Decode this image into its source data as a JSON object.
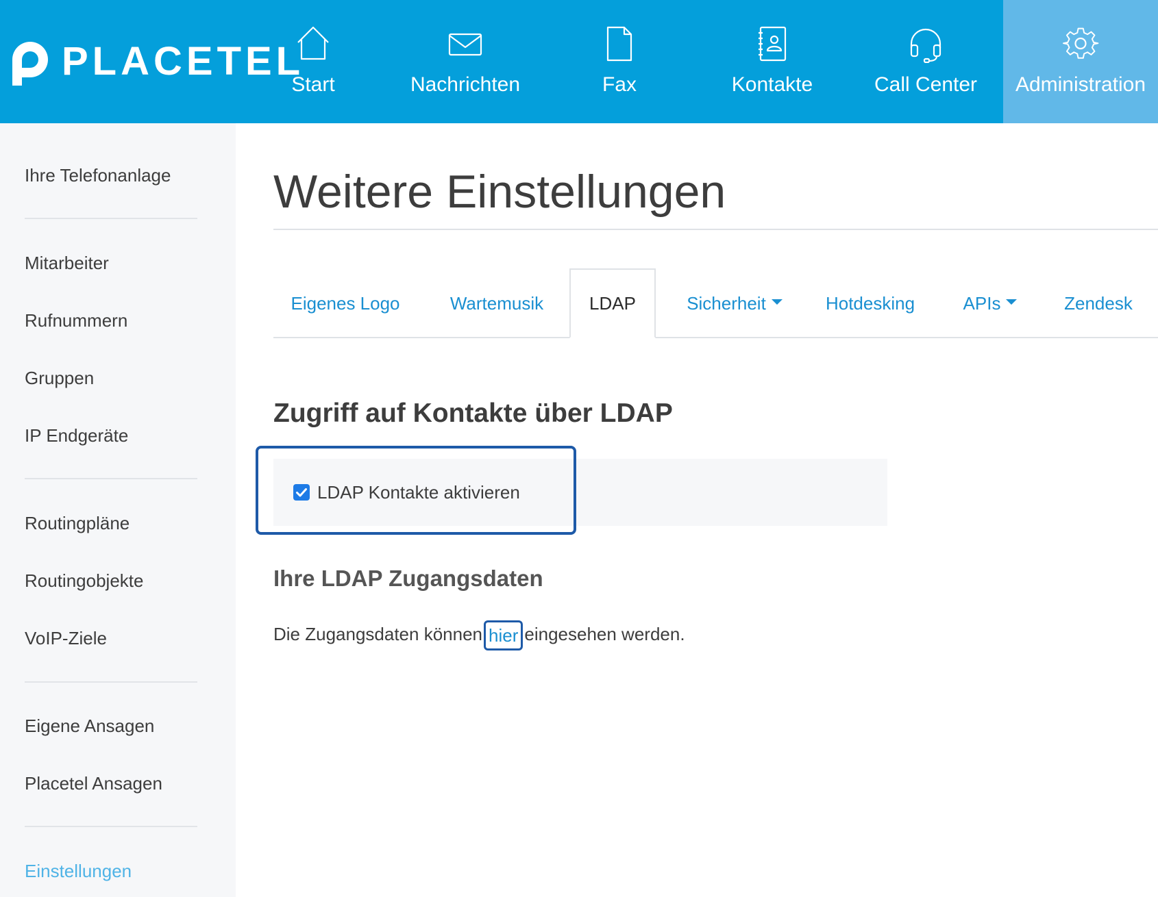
{
  "brand": {
    "name": "PLACETEL"
  },
  "nav": {
    "items": [
      {
        "label": "Start",
        "icon": "home-icon"
      },
      {
        "label": "Nachrichten",
        "icon": "envelope-icon"
      },
      {
        "label": "Fax",
        "icon": "document-icon"
      },
      {
        "label": "Kontakte",
        "icon": "address-book-icon"
      },
      {
        "label": "Call Center",
        "icon": "headset-icon"
      },
      {
        "label": "Administration",
        "icon": "gear-icon",
        "active": true
      }
    ]
  },
  "sidebar": {
    "items": [
      {
        "label": "Ihre Telefonanlage"
      },
      {
        "label": "Mitarbeiter"
      },
      {
        "label": "Rufnummern"
      },
      {
        "label": "Gruppen"
      },
      {
        "label": "IP Endgeräte"
      },
      {
        "label": "Routingpläne"
      },
      {
        "label": "Routingobjekte"
      },
      {
        "label": "VoIP-Ziele"
      },
      {
        "label": "Eigene Ansagen"
      },
      {
        "label": "Placetel Ansagen"
      },
      {
        "label": "Einstellungen",
        "selected": true
      }
    ]
  },
  "page": {
    "title": "Weitere Einstellungen",
    "tabs": [
      {
        "label": "Eigenes Logo"
      },
      {
        "label": "Wartemusik"
      },
      {
        "label": "LDAP",
        "active": true
      },
      {
        "label": "Sicherheit",
        "dropdown": true
      },
      {
        "label": "Hotdesking"
      },
      {
        "label": "APIs",
        "dropdown": true
      },
      {
        "label": "Zendesk"
      }
    ],
    "section_title": "Zugriff auf Kontakte über LDAP",
    "ldap_checkbox": {
      "label": "LDAP Kontakte aktivieren",
      "checked": true
    },
    "credentials_title": "Ihre LDAP Zugangsdaten",
    "credentials_text_before": "Die Zugangsdaten können",
    "credentials_link": "hier",
    "credentials_text_after": "eingesehen werden."
  },
  "colors": {
    "topbar": "#049fdb",
    "nav_active": "#61b8e8",
    "link": "#1a8fd1",
    "highlight": "#1e5aa8",
    "sidebar_bg": "#f6f7f9",
    "sidebar_selected": "#4fb3e6"
  }
}
